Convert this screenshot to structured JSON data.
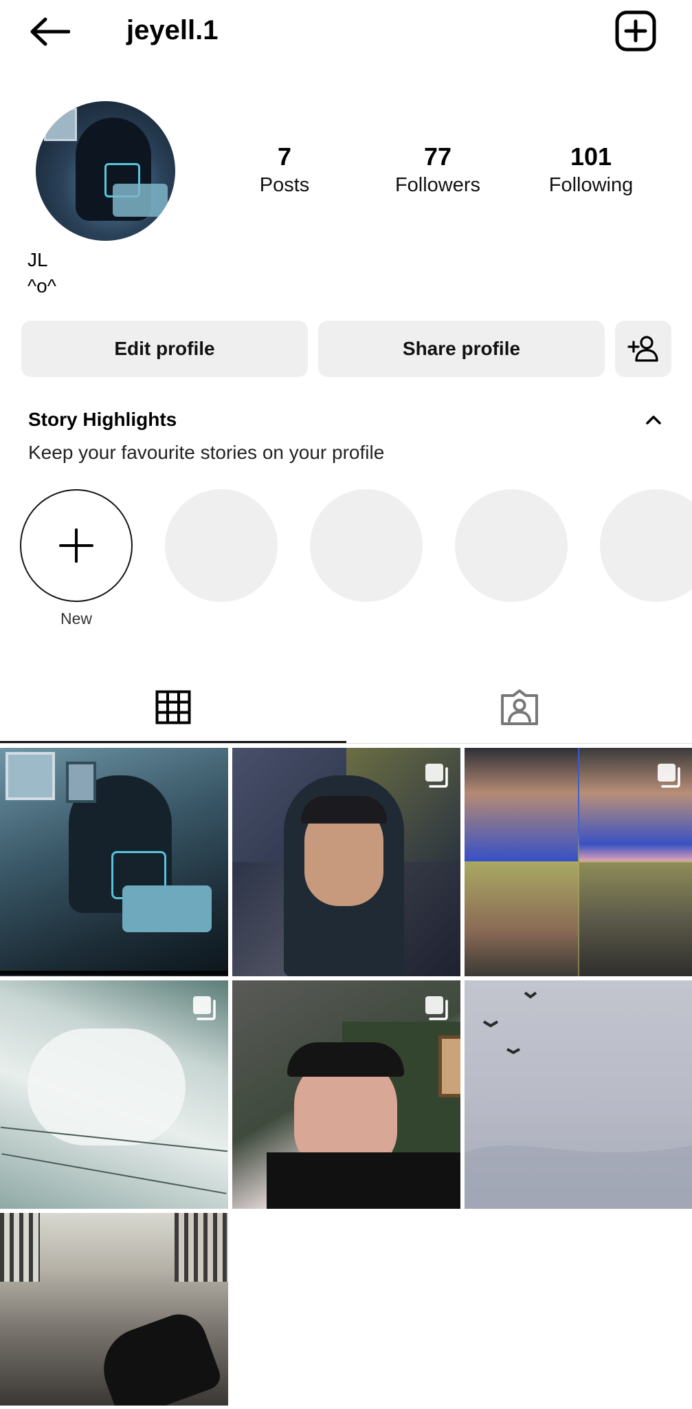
{
  "header": {
    "username": "jeyell.1",
    "back_icon": "arrow-left-icon",
    "add_icon": "plus-square-icon"
  },
  "profile": {
    "stats": [
      {
        "value": "7",
        "label": "Posts"
      },
      {
        "value": "77",
        "label": "Followers"
      },
      {
        "value": "101",
        "label": "Following"
      }
    ],
    "name": "JL",
    "bio": "^o^"
  },
  "actions": {
    "edit_label": "Edit profile",
    "share_label": "Share profile",
    "add_user_icon": "person-add-icon"
  },
  "highlights": {
    "title": "Story Highlights",
    "subtitle": "Keep your favourite stories on your profile",
    "new_label": "New",
    "toggle_icon": "chevron-up-icon"
  },
  "tabs": {
    "grid_icon": "grid-icon",
    "tagged_icon": "tagged-person-icon",
    "active": "grid"
  },
  "colors": {
    "button_bg": "#efefef",
    "text": "#000000",
    "divider": "#dbdbdb"
  }
}
